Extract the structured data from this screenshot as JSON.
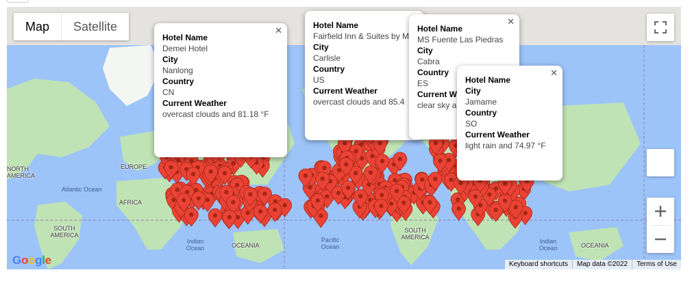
{
  "map_type": {
    "map_label": "Map",
    "satellite_label": "Satellite",
    "active": "Map"
  },
  "attribution": {
    "shortcuts": "Keyboard shortcuts",
    "map_data": "Map data ©2022",
    "terms": "Terms of Use"
  },
  "logo_text": "Google",
  "map_labels": {
    "north_america": "NORTH AMERICA",
    "europe": "EUROPE",
    "africa": "AFRICA",
    "south_america": "SOUTH AMERICA",
    "oceania_1": "OCEANIA",
    "oceania_2": "OCEANIA",
    "south_america_2": "SOUTH AMERICA",
    "atlantic": "Atlantic Ocean",
    "indian_1": "Indian Ocean",
    "indian_2": "Indian Ocean",
    "pacific": "Pacific Ocean"
  },
  "field_labels": {
    "hotel": "Hotel Name",
    "city": "City",
    "country": "Country",
    "weather": "Current Weather"
  },
  "info_windows": [
    {
      "hotel": "Demei Hotel",
      "city": "Nanlong",
      "country": "CN",
      "weather": "overcast clouds and 81.18 °F"
    },
    {
      "hotel": "Fairfield Inn & Suites by M",
      "city": "Carlisle",
      "country": "US",
      "weather": "overcast clouds and 85.4"
    },
    {
      "hotel": "MS Fuente Las Piedras",
      "city": "Cabra",
      "country": "ES",
      "weather": "clear sky a"
    },
    {
      "hotel": "",
      "city": "Jamame",
      "country": "SO",
      "weather": "light rain and 74.97 °F"
    }
  ],
  "colors": {
    "water": "#9dc4f8",
    "land": "#bfe3b4",
    "land_dark": "#a6d89b",
    "ice": "#f4f6f4",
    "marker": "#ea4335",
    "marker_stroke": "#a52714"
  },
  "icons": {
    "fullscreen": "fullscreen-icon",
    "zoom_in": "plus-icon",
    "zoom_out": "minus-icon",
    "pegman": "pegman-icon",
    "close": "close-icon",
    "marker": "map-marker-icon"
  }
}
